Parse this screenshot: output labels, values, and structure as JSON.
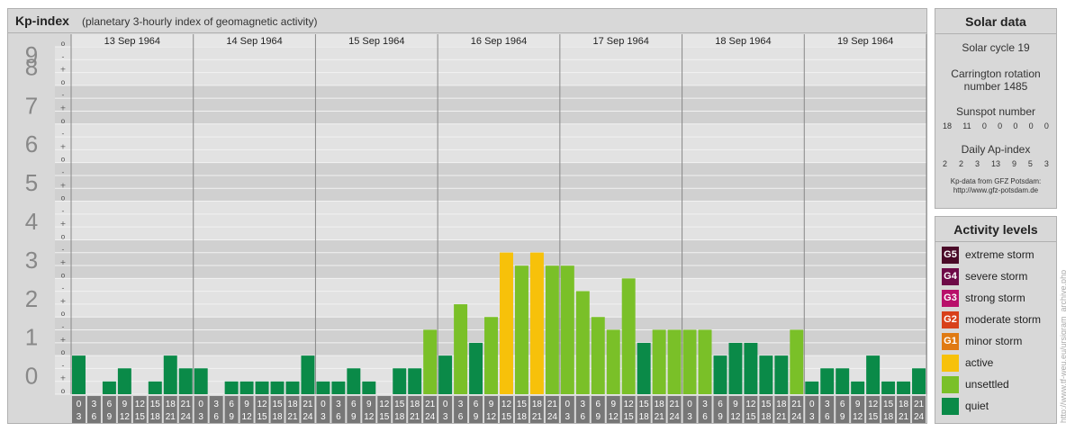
{
  "header": {
    "title": "Kp-index",
    "subtitle": "(planetary 3-hourly index of geomagnetic activity)"
  },
  "chart_data": {
    "type": "bar",
    "title": "Kp-index",
    "subtitle": "(planetary 3-hourly index of geomagnetic activity)",
    "ylim": [
      0,
      9
    ],
    "y_ticks": [
      "0",
      "1",
      "2",
      "3",
      "4",
      "5",
      "6",
      "7",
      "8",
      "9"
    ],
    "y_subticks": [
      "o",
      "-",
      "+"
    ],
    "days": [
      "13 Sep 1964",
      "14 Sep 1964",
      "15 Sep 1964",
      "16 Sep 1964",
      "17 Sep 1964",
      "18 Sep 1964",
      "19 Sep 1964"
    ],
    "interval_labels": [
      [
        "0",
        "3"
      ],
      [
        "3",
        "6"
      ],
      [
        "6",
        "9"
      ],
      [
        "9",
        "12"
      ],
      [
        "12",
        "15"
      ],
      [
        "15",
        "18"
      ],
      [
        "18",
        "21"
      ],
      [
        "21",
        "24"
      ]
    ],
    "values": [
      1.0,
      0.0,
      0.33,
      0.67,
      0.0,
      0.33,
      1.0,
      0.67,
      0.67,
      0.0,
      0.33,
      0.33,
      0.33,
      0.33,
      0.33,
      1.0,
      0.33,
      0.33,
      0.67,
      0.33,
      0.0,
      0.67,
      0.67,
      1.67,
      1.0,
      2.33,
      1.33,
      2.0,
      3.67,
      3.33,
      3.67,
      3.33,
      3.33,
      2.67,
      2.0,
      1.67,
      3.0,
      1.33,
      1.67,
      1.67,
      1.67,
      1.67,
      1.0,
      1.33,
      1.33,
      1.0,
      1.0,
      1.67,
      0.33,
      0.67,
      0.67,
      0.33,
      1.0,
      0.33,
      0.33,
      0.67
    ],
    "grid": true
  },
  "solar": {
    "title": "Solar data",
    "cycle": "Solar cycle 19",
    "carrington_1": "Carrington rotation",
    "carrington_2": "number 1485",
    "sunspot_title": "Sunspot number",
    "sunspot_values": [
      "18",
      "11",
      "0",
      "0",
      "0",
      "0",
      "0"
    ],
    "ap_title": "Daily Ap-index",
    "ap_values": [
      "2",
      "2",
      "3",
      "13",
      "9",
      "5",
      "3"
    ],
    "source_1": "Kp-data from GFZ Potsdam:",
    "source_2": "http://www.gfz-potsdam.de"
  },
  "activity": {
    "title": "Activity levels",
    "levels": [
      {
        "code": "G5",
        "label": "extreme storm",
        "color": "#4a0a28"
      },
      {
        "code": "G4",
        "label": "severe storm",
        "color": "#6e0a48"
      },
      {
        "code": "G3",
        "label": "strong storm",
        "color": "#b8106a"
      },
      {
        "code": "G2",
        "label": "moderate storm",
        "color": "#d8401a"
      },
      {
        "code": "G1",
        "label": "minor storm",
        "color": "#e07a12"
      },
      {
        "code": "",
        "label": "active",
        "color": "#f7c10a"
      },
      {
        "code": "",
        "label": "unsettled",
        "color": "#7ac028"
      },
      {
        "code": "",
        "label": "quiet",
        "color": "#0a8a48"
      }
    ]
  },
  "watermark": "http://www.tf-weu.eu/ursigram_archive.php"
}
